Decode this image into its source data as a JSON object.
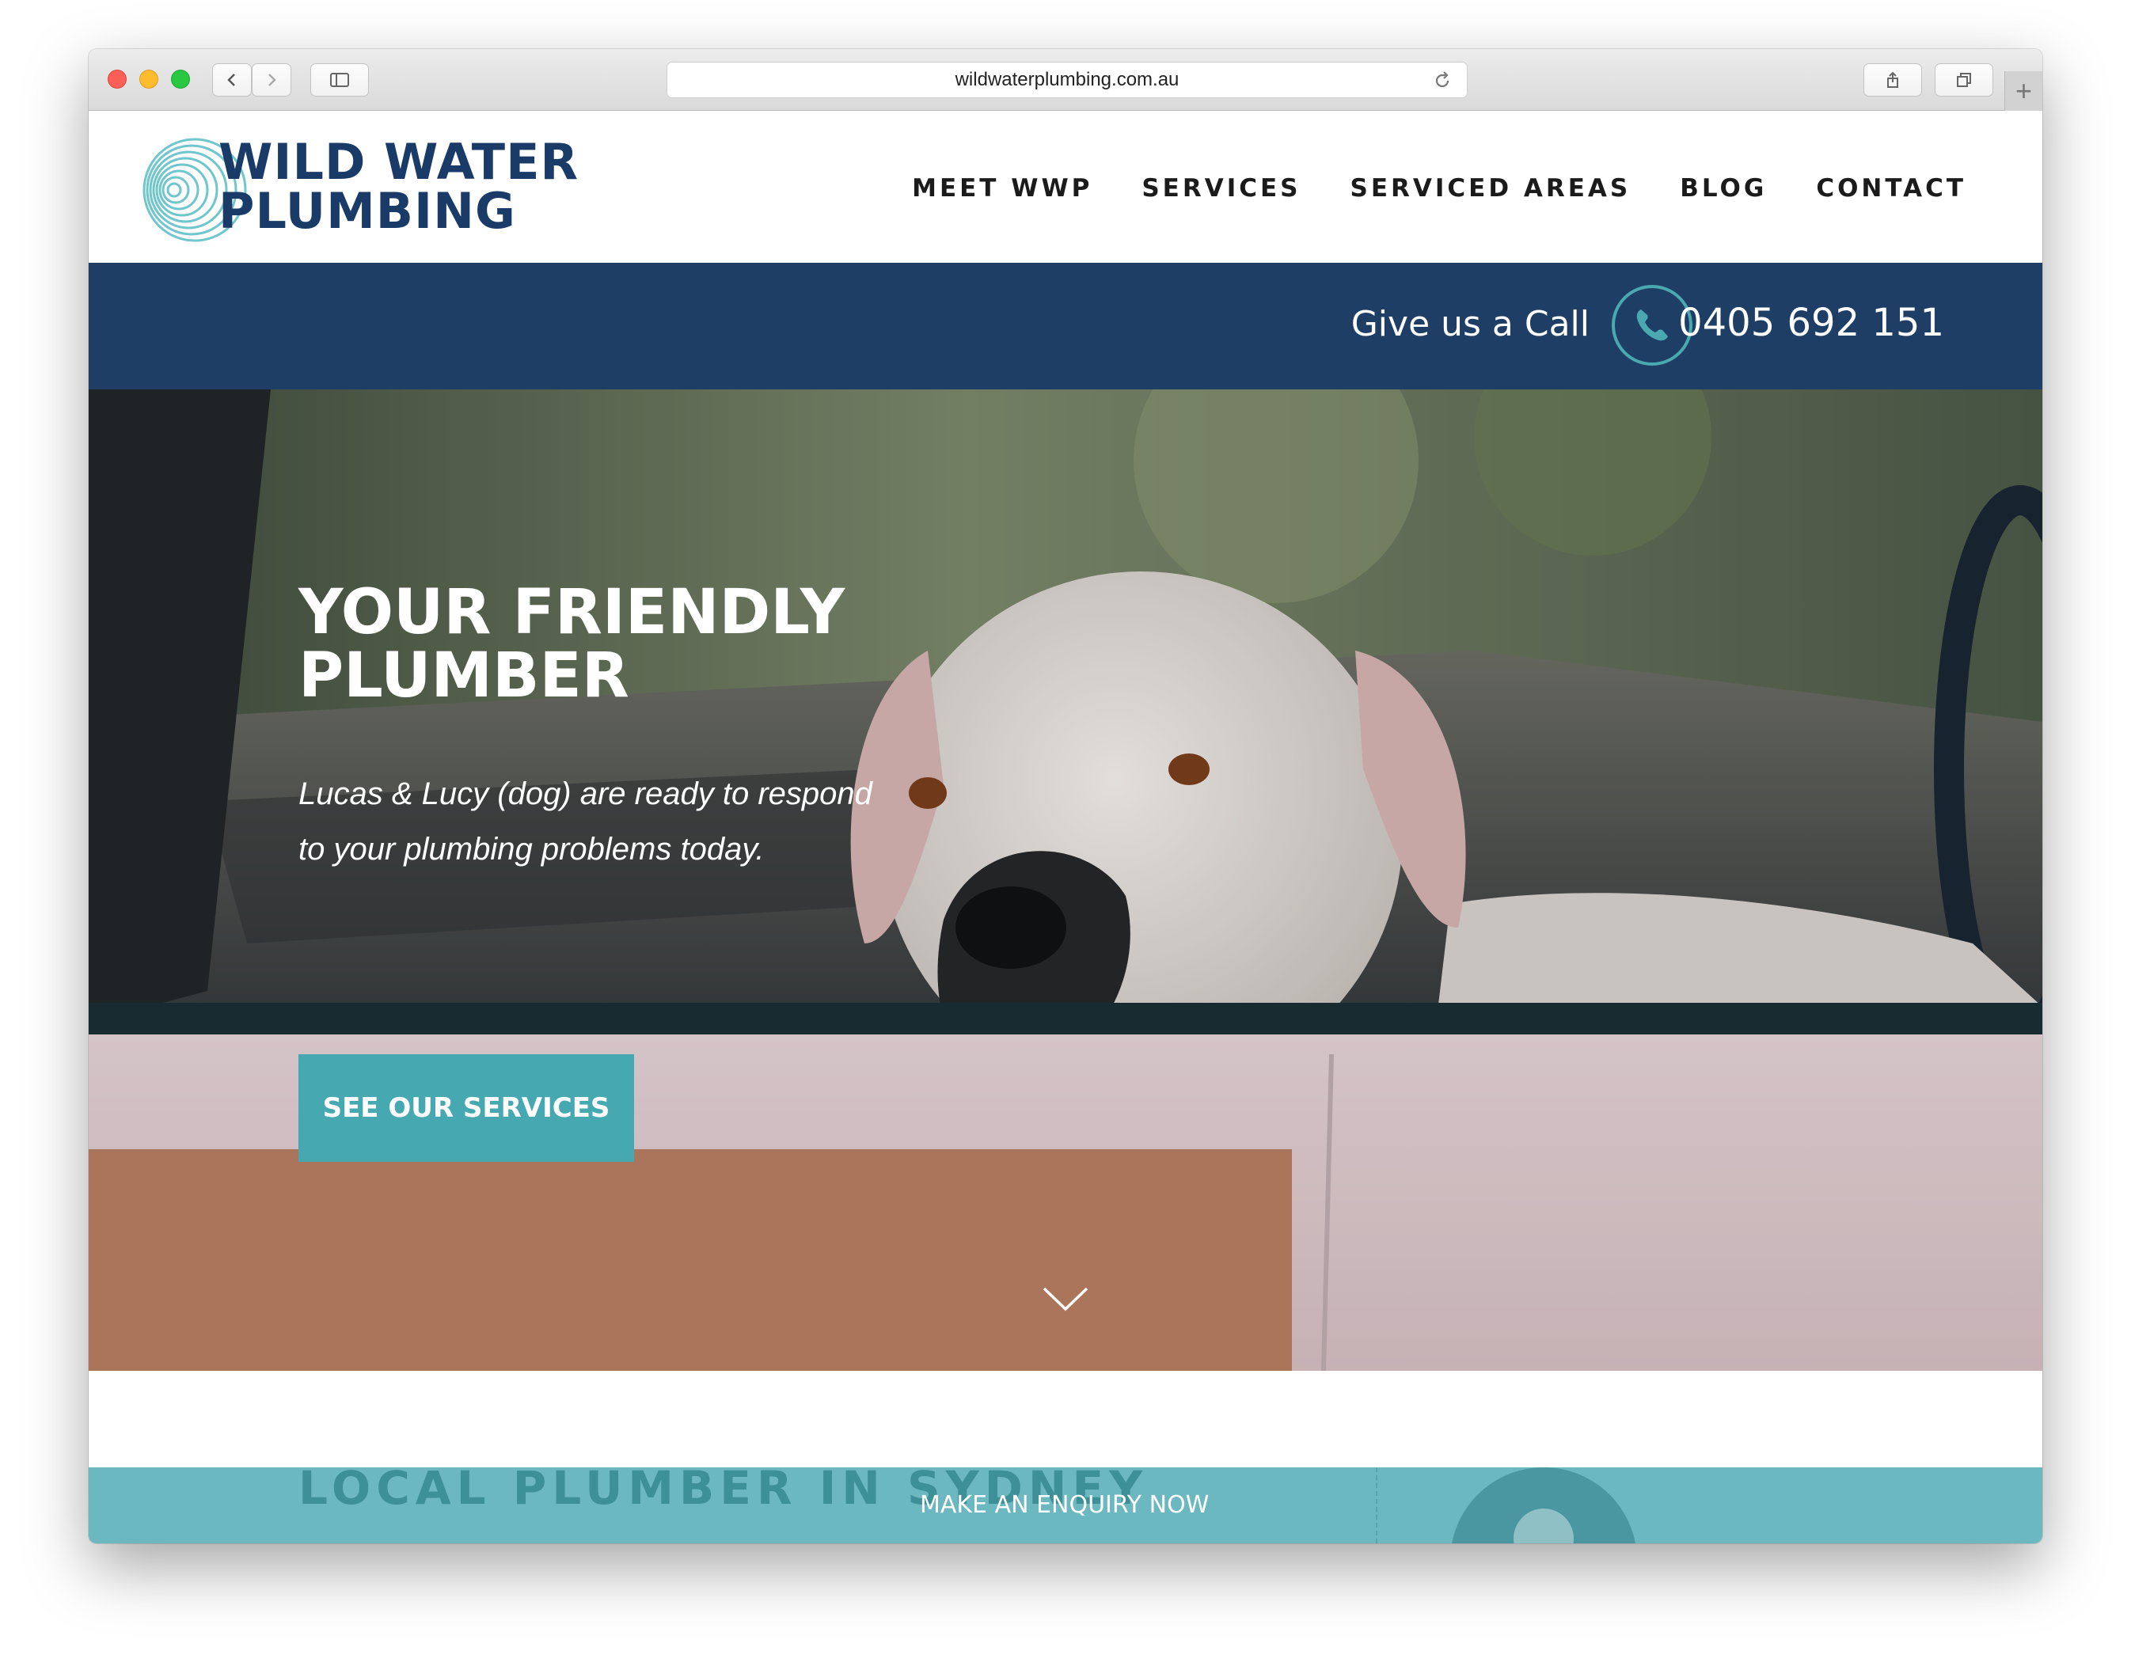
{
  "browser": {
    "url": "wildwaterplumbing.com.au",
    "new_tab": "+"
  },
  "site": {
    "logo_line1": "WILD WATER",
    "logo_line2": "PLUMBING",
    "nav": [
      "MEET WWP",
      "SERVICES",
      "SERVICED AREAS",
      "BLOG",
      "CONTACT"
    ]
  },
  "call_bar": {
    "label": "Give us a Call",
    "phone": "0405 692 151"
  },
  "hero": {
    "title_line1": "YOUR FRIENDLY",
    "title_line2": "PLUMBER",
    "sub_line1": "Lucas & Lucy (dog) are ready to respond",
    "sub_line2": "to your plumbing problems today.",
    "button": "SEE OUR SERVICES"
  },
  "section": {
    "heading": "LOCAL PLUMBER IN SYDNEY",
    "enquiry": "MAKE AN ENQUIRY NOW"
  },
  "colors": {
    "navy": "#1f3e66",
    "teal": "#46a9b2",
    "teal_light": "#6bb8c0",
    "logo": "#1a3b68"
  }
}
